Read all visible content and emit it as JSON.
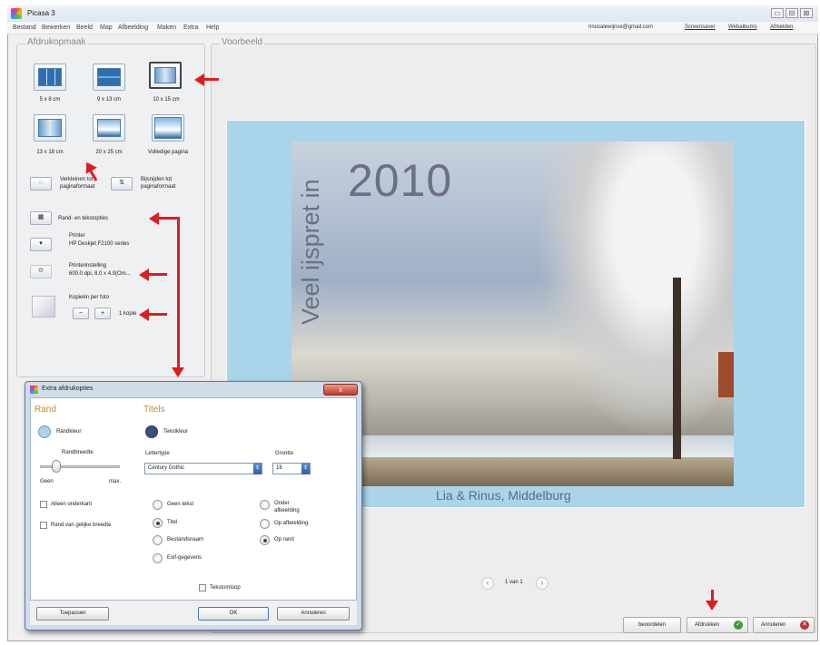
{
  "window": {
    "title": "Picasa 3",
    "minimize": "▭",
    "maximize": "⊟",
    "close": "⊠"
  },
  "menu": [
    "Bestand",
    "Bewerken",
    "Beeld",
    "Map",
    "Afbeelding",
    "Maken",
    "Extra",
    "Help"
  ],
  "account": {
    "email": "rinusalewijnse@gmail.com",
    "links": [
      "Screensaver",
      "Webalbums",
      "Afmelden"
    ]
  },
  "left": {
    "title": "Afdrukopmaak",
    "layouts": [
      "5 x 8 cm",
      "9 x 13 cm",
      "10 x 15 cm",
      "13 x 18 cm",
      "20 x 25 cm",
      "Volledige pagina"
    ],
    "shrink": "Verkleinen tot paginaformaat",
    "crop": "Bijsnijden tot paginaformaat",
    "border_text": "Rand- en tekstopties",
    "printer_label": "Printer",
    "printer_name": "HP Deskjet F2100 series",
    "print_settings_label": "Printerinstelling",
    "print_settings_value": "600.0 dpi, 8.0 x 4.0(Om...",
    "copies_label": "Kopieën per foto",
    "copies_minus": "−",
    "copies_plus": "+",
    "copies_value": "1 kopie"
  },
  "preview": {
    "title": "Voorbeeld",
    "year": "2010",
    "vertical_text": "Veel ijspret in",
    "caption": "Lia & Rinus, Middelburg",
    "pager": "1 van 1",
    "prev": "‹",
    "next": "›"
  },
  "bottom": {
    "review": "beoordelen",
    "print": "Afdrukken",
    "cancel": "Annuleren"
  },
  "dialog": {
    "title": "Extra afdrukopties",
    "close": "x",
    "rand": {
      "head": "Rand",
      "color_label": "Randkleur",
      "width_label": "Randbreedte",
      "min": "Geen",
      "max": "max.",
      "only_bottom": "Alleen onderkant",
      "equal_width": "Rand van gelijke breedte"
    },
    "titels": {
      "head": "Titels",
      "color_label": "Tekstkleur",
      "font_label": "Lettertype",
      "font_value": "Century Gothic",
      "size_label": "Grootte",
      "size_value": "16"
    },
    "radio_left": [
      "Geen tekst",
      "Titel",
      "Bestandsnaam",
      "Exif-gegevens"
    ],
    "radio_right": [
      "Onder afbeelding",
      "Op afbeelding",
      "Op rand"
    ],
    "wrap": "Tekstomloop",
    "apply": "Toepassen",
    "ok": "OK",
    "cancel": "Annuleren"
  },
  "colors": {
    "accent_arrow": "#e01b1b",
    "paper": "#a9d4ea",
    "title_text": "#6c6f86",
    "heading": "#c8892a"
  }
}
